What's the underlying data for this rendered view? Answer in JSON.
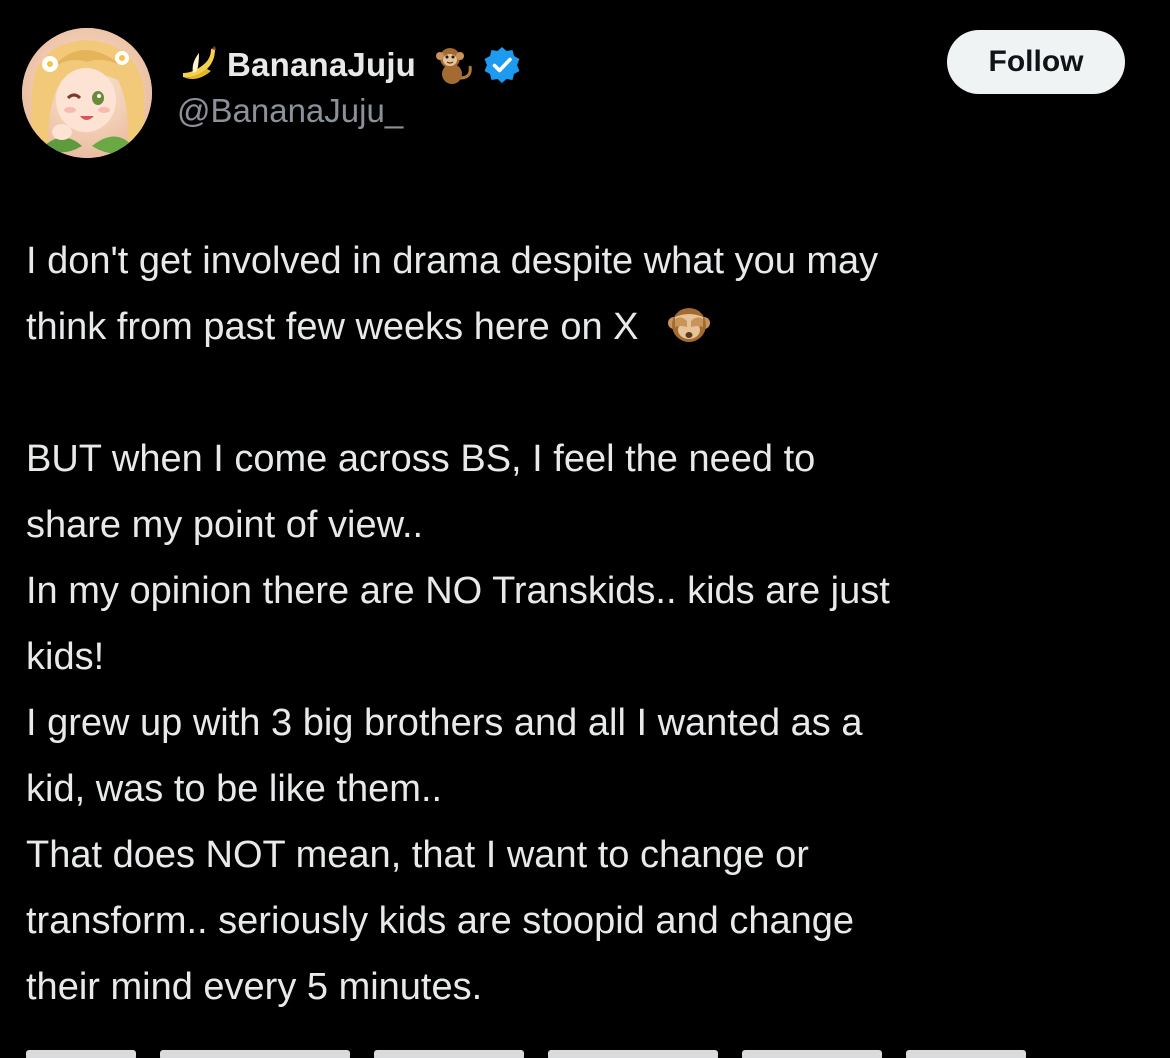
{
  "author": {
    "display_name": "BananaJuju",
    "handle": "@BananaJuju_",
    "icons": [
      "banana-icon",
      "monkey-icon",
      "verified-icon"
    ],
    "verified_color": "#1d9bf0"
  },
  "actions": {
    "follow_label": "Follow"
  },
  "tweet": {
    "line_1": "I don't get involved in drama despite what you may",
    "line_2": "think from past few weeks here on X",
    "line_2_emoji": "see-no-evil-monkey-icon",
    "line_3": "BUT when I come across BS, I feel the need to",
    "line_4": "share my point of view..",
    "line_5": "In my opinion there are NO Transkids.. kids are just",
    "line_6": "kids!",
    "line_7": "I grew up with 3 big brothers and all I wanted as a",
    "line_8": "kid, was to be like them..",
    "line_9": "That does NOT mean, that I want to change or",
    "line_10": "transform.. seriously kids are stoopid and change",
    "line_11": "their mind every 5 minutes."
  },
  "colors": {
    "background": "#000000",
    "text_primary": "#e7e9ea",
    "text_secondary": "#8b9199",
    "follow_bg": "#eff3f4"
  }
}
